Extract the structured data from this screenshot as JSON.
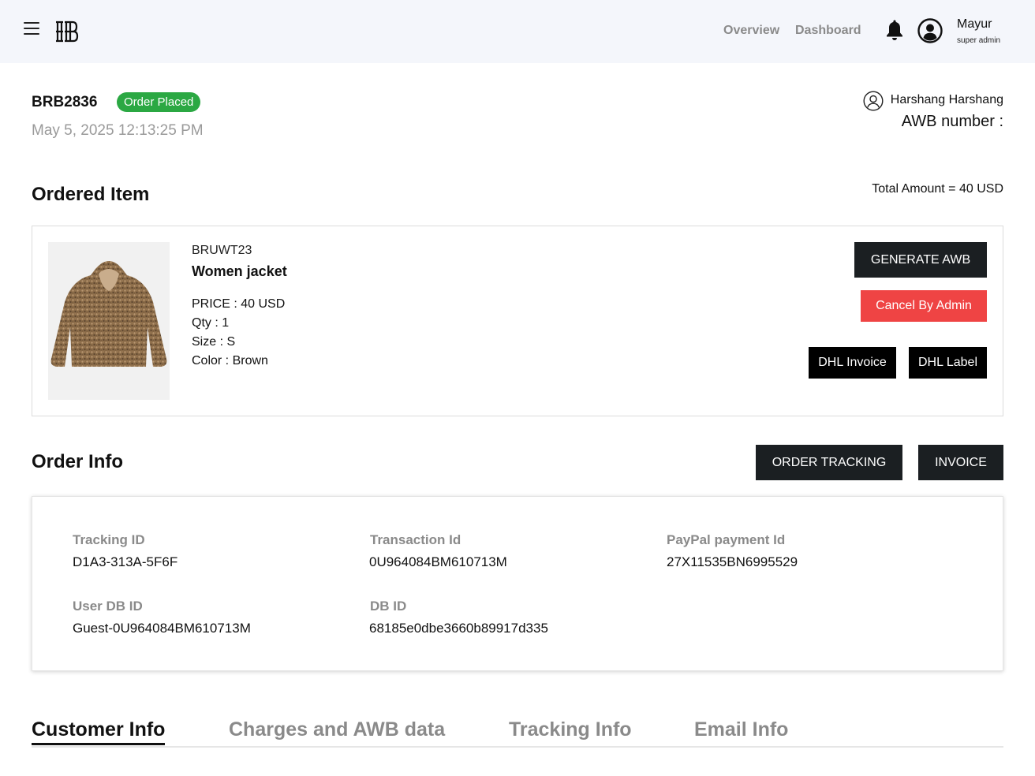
{
  "header": {
    "nav": [
      "Overview",
      "Dashboard"
    ],
    "user": {
      "name": "Mayur",
      "role": "super admin"
    }
  },
  "order": {
    "id": "BRB2836",
    "status": "Order Placed",
    "date": "May 5, 2025 12:13:25 PM",
    "customer_name": "Harshang Harshang",
    "awb_label": "AWB number :"
  },
  "ordered_item": {
    "section_title": "Ordered Item",
    "total_amount": "Total Amount = 40 USD",
    "sku": "BRUWT23",
    "name": "Women jacket",
    "price": "PRICE : 40 USD",
    "qty": "Qty : 1",
    "size": "Size : S",
    "color": "Color : Brown",
    "buttons": {
      "generate_awb": "GENERATE AWB",
      "cancel": "Cancel By Admin",
      "dhl_invoice": "DHL Invoice",
      "dhl_label": "DHL Label"
    }
  },
  "order_info": {
    "section_title": "Order Info",
    "buttons": {
      "tracking": "ORDER TRACKING",
      "invoice": "INVOICE"
    },
    "fields": {
      "tracking_id": {
        "label": "Tracking ID",
        "value": "D1A3-313A-5F6F"
      },
      "transaction_id": {
        "label": "Transaction Id",
        "value": "0U964084BM610713M"
      },
      "paypal_id": {
        "label": "PayPal payment Id",
        "value": "27X11535BN6995529"
      },
      "user_db_id": {
        "label": "User DB ID",
        "value": "Guest-0U964084BM610713M"
      },
      "db_id": {
        "label": "DB ID",
        "value": "68185e0dbe3660b89917d335"
      }
    }
  },
  "tabs": [
    "Customer Info",
    "Charges and AWB data",
    "Tracking Info",
    "Email Info"
  ],
  "active_tab": "Customer Info",
  "colors": {
    "status_green": "#2ba843",
    "cancel_red": "#ef4444",
    "dark_button": "#1b1f22",
    "topbar_bg": "#f4f6fb"
  },
  "icons": [
    "menu-icon",
    "brand-logo",
    "bell-icon",
    "user-circle-icon",
    "customer-icon"
  ]
}
